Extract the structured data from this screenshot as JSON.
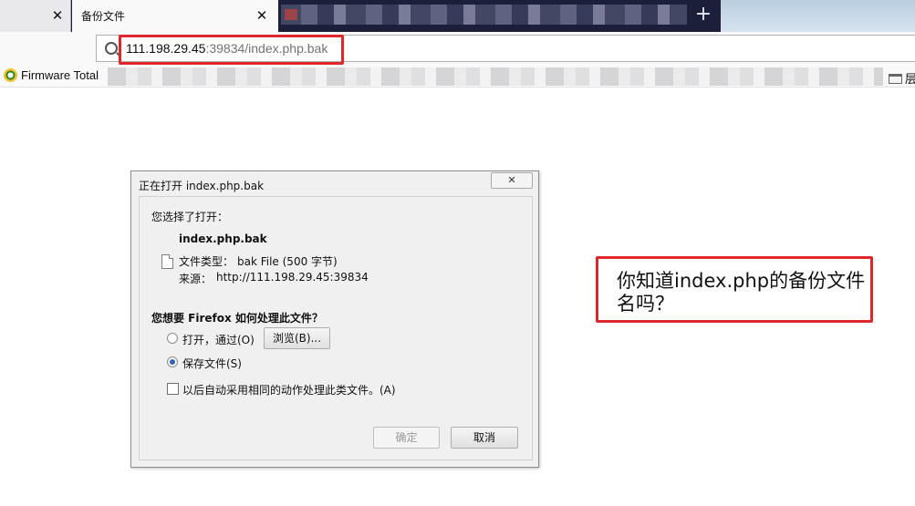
{
  "tabs": [
    {
      "title": "",
      "close_glyph": "✕"
    },
    {
      "title": "备份文件",
      "close_glyph": "✕"
    }
  ],
  "new_tab_glyph": "+",
  "url": {
    "host": "111.198.29.45",
    "rest": ":39834/index.php.bak"
  },
  "bookmarks": {
    "first": "Firmware Total",
    "folder": "层"
  },
  "dialog": {
    "title": "正在打开 index.php.bak",
    "close_glyph": "✕",
    "chosen_label": "您选择了打开：",
    "filename": "index.php.bak",
    "filetype_label": "文件类型：",
    "filetype_value": "bak File (500 字节)",
    "source_label": "来源：",
    "source_value": "http://111.198.29.45:39834",
    "question": "您想要 Firefox 如何处理此文件？",
    "open_with_label": "打开，通过(O)",
    "browse_label": "浏览(B)...",
    "save_label": "保存文件(S)",
    "auto_label": "以后自动采用相同的动作处理此类文件。(A)",
    "ok_label": "确定",
    "cancel_label": "取消",
    "selected_option": "save"
  },
  "annotation": {
    "text": "你知道index.php的备份文件名吗？"
  },
  "colors": {
    "highlight": "#e0262b",
    "tabbar": "#1b1f3a",
    "radio_dot": "#2d64b7"
  }
}
